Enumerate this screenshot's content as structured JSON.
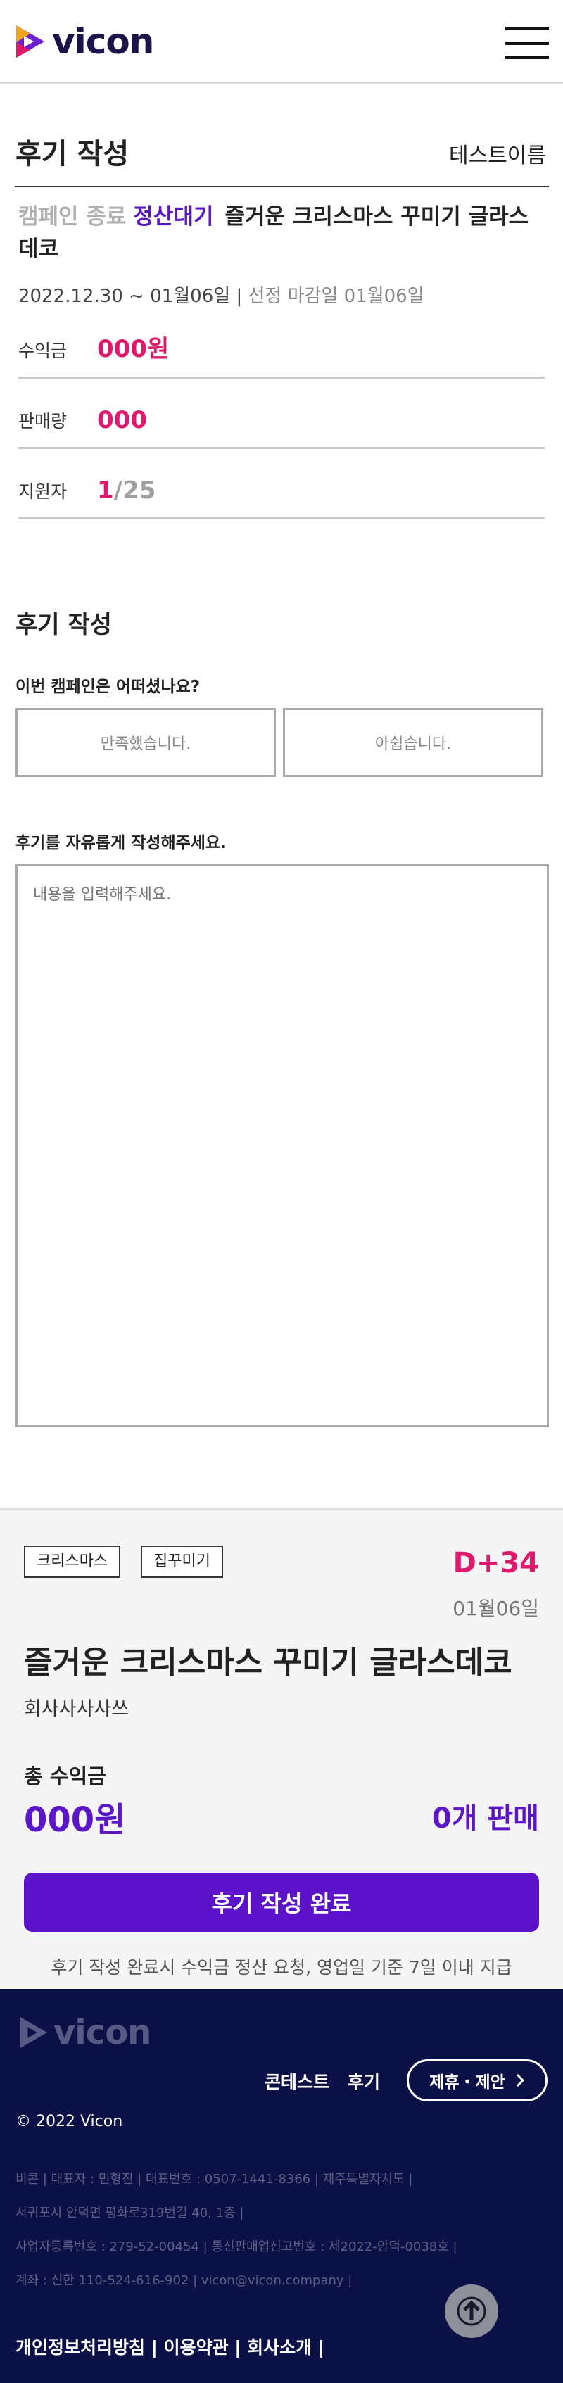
{
  "header": {
    "logo_text": "vicon",
    "menu_icon": "hamburger-icon"
  },
  "page": {
    "title": "후기 작성",
    "user_name": "테스트이름"
  },
  "campaign": {
    "status_ended": "캠페인 종료",
    "status_pending": "정산대기",
    "title": "즐거운 크리스마스 꾸미기 글라스데코",
    "period": "2022.12.30 ~ 01월06일 |",
    "deadline": "선정 마감일 01월06일"
  },
  "stats": {
    "earnings_label": "수익금",
    "earnings_value": "000원",
    "sales_label": "판매량",
    "sales_value": "000",
    "applicants_label": "지원자",
    "applicants_count": "1",
    "applicants_total": "/25"
  },
  "review": {
    "section_title": "후기 작성",
    "question": "이번 캠페인은 어떠셨나요?",
    "option_satisfied": "만족했습니다.",
    "option_regret": "아쉽습니다.",
    "free_label": "후기를 자유롭게 작성해주세요.",
    "placeholder": "내용을 입력해주세요."
  },
  "summary": {
    "tags": [
      "크리스마스",
      "집꾸미기"
    ],
    "dday": "D+34",
    "end_date": "01월06일",
    "title": "즐거운 크리스마스 꾸미기 글라스데코",
    "company": "회사사사사쓰",
    "total_label": "총 수익금",
    "total_value": "000원",
    "sold_value": "0개 판매",
    "submit_label": "후기 작성 완료",
    "notice": "후기 작성 완료시 수익금 정산 요청, 영업일 기준 7일 이내 지급"
  },
  "footer": {
    "logo_text": "vicon",
    "nav": [
      "콘테스트",
      "후기"
    ],
    "partner_label": "제휴・제안",
    "copyright": "© 2022 Vicon",
    "biz_lines": [
      "비콘 | 대표자 : 민형진 | 대표번호 : 0507-1441-8366 | 제주특별자치도 |",
      "서귀포시 안덕면 평화로319번길 40, 1층 |",
      "사업자등록번호 : 279-52-00454 | 통신판매업신고번호 : 제2022-안덕-0038호 |",
      "계좌 : 신한 110-524-616-902 | vicon@vicon.company |"
    ],
    "links": [
      "개인정보처리방침",
      "이용약관",
      "회사소개"
    ]
  },
  "colors": {
    "accent_purple": "#5b12c9",
    "accent_pink": "#e0186c",
    "footer_bg": "#0b1146"
  }
}
